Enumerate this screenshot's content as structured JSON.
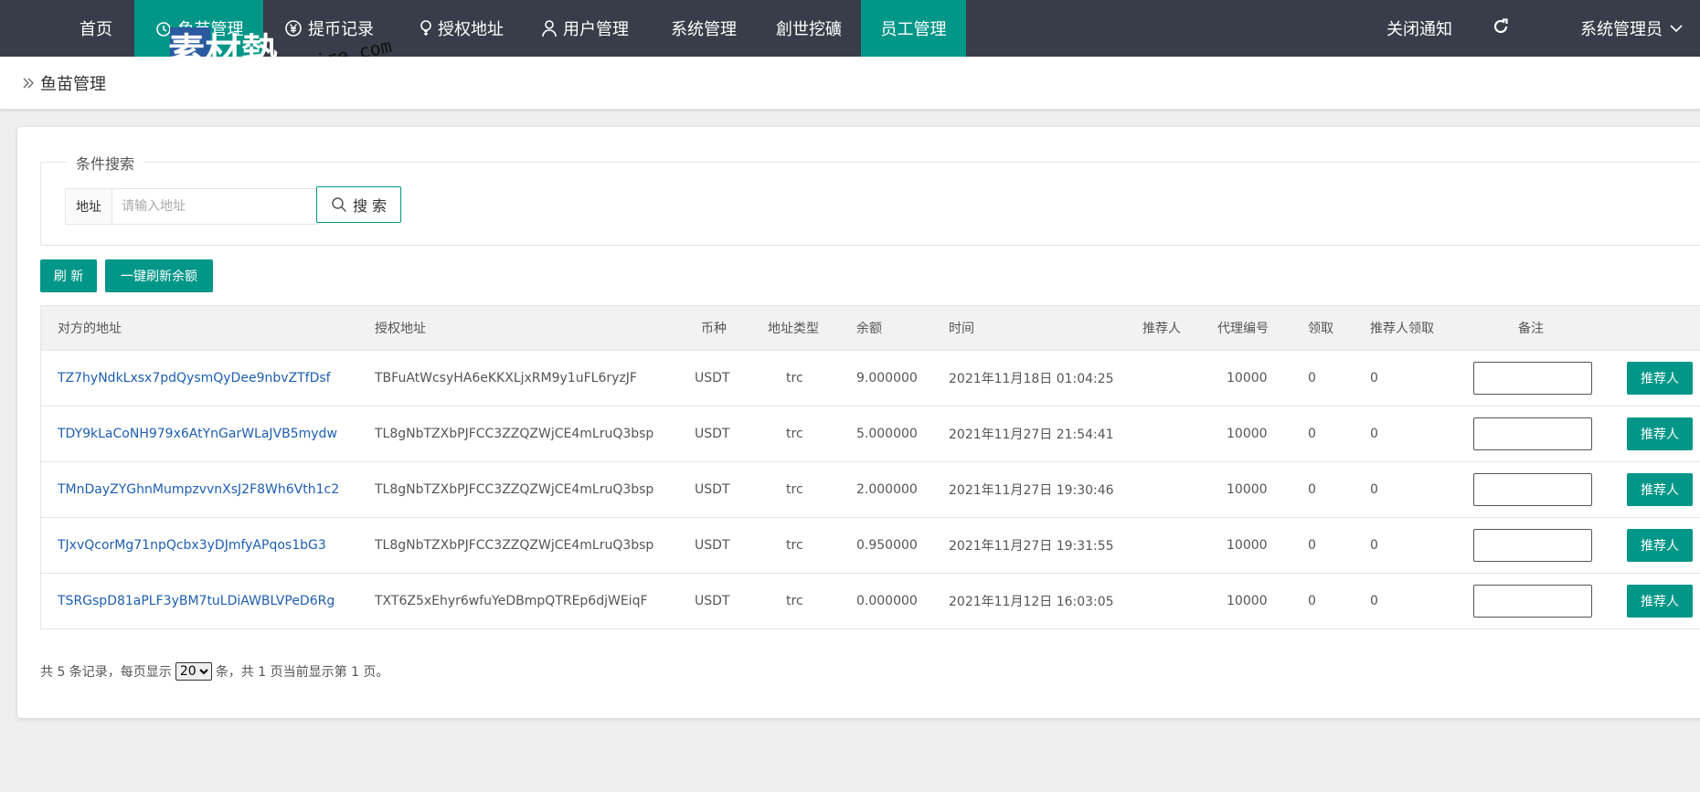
{
  "nav": {
    "items": [
      {
        "label": "首页"
      },
      {
        "label": "鱼苗管理"
      },
      {
        "label": "提币记录"
      },
      {
        "label": "授权地址"
      },
      {
        "label": "用户管理"
      },
      {
        "label": "系统管理"
      },
      {
        "label": "創世挖礦"
      },
      {
        "label": "员工管理"
      }
    ],
    "notify_label": "关闭通知",
    "admin_label": "系统管理员",
    "active_color": "#009688",
    "bar_color": "#393d49"
  },
  "watermark": {
    "text_cn": "素材熱",
    "text_en": "sucaire.com"
  },
  "breadcrumb": {
    "title": "鱼苗管理"
  },
  "search": {
    "legend": "条件搜索",
    "field_label": "地址",
    "placeholder": "请输入地址",
    "button_label": "搜 索"
  },
  "actions": {
    "refresh_label": "刷 新",
    "refresh_balance_label": "一键刷新余额"
  },
  "table": {
    "headers": [
      "对方的地址",
      "授权地址",
      "币种",
      "地址类型",
      "余额",
      "时间",
      "推荐人",
      "代理编号",
      "领取",
      "推荐人领取",
      "备注"
    ],
    "rows": [
      {
        "counterparty": "TZ7hyNdkLxsx7pdQysmQyDee9nbvZTfDsf",
        "auth": "TBFuAtWcsyHA6eKKXLjxRM9y1uFL6ryzJF",
        "coin": "USDT",
        "type": "trc",
        "balance": "9.000000",
        "time": "2021年11月18日 01:04:25",
        "referrer": "",
        "agent": "10000",
        "claim": "0",
        "ref_claim": "0",
        "remark": "",
        "button": "推荐人"
      },
      {
        "counterparty": "TDY9kLaCoNH979x6AtYnGarWLaJVB5mydw",
        "auth": "TL8gNbTZXbPJFCC3ZZQZWjCE4mLruQ3bsp",
        "coin": "USDT",
        "type": "trc",
        "balance": "5.000000",
        "time": "2021年11月27日 21:54:41",
        "referrer": "",
        "agent": "10000",
        "claim": "0",
        "ref_claim": "0",
        "remark": "",
        "button": "推荐人"
      },
      {
        "counterparty": "TMnDayZYGhnMumpzvvnXsJ2F8Wh6Vth1c2",
        "auth": "TL8gNbTZXbPJFCC3ZZQZWjCE4mLruQ3bsp",
        "coin": "USDT",
        "type": "trc",
        "balance": "2.000000",
        "time": "2021年11月27日 19:30:46",
        "referrer": "",
        "agent": "10000",
        "claim": "0",
        "ref_claim": "0",
        "remark": "",
        "button": "推荐人"
      },
      {
        "counterparty": "TJxvQcorMg71npQcbx3yDJmfyAPqos1bG3",
        "auth": "TL8gNbTZXbPJFCC3ZZQZWjCE4mLruQ3bsp",
        "coin": "USDT",
        "type": "trc",
        "balance": "0.950000",
        "time": "2021年11月27日 19:31:55",
        "referrer": "",
        "agent": "10000",
        "claim": "0",
        "ref_claim": "0",
        "remark": "",
        "button": "推荐人"
      },
      {
        "counterparty": "TSRGspD81aPLF3yBM7tuLDiAWBLVPeD6Rg",
        "auth": "TXT6Z5xEhyr6wfuYeDBmpQTREp6djWEiqF",
        "coin": "USDT",
        "type": "trc",
        "balance": "0.000000",
        "time": "2021年11月12日 16:03:05",
        "referrer": "",
        "agent": "10000",
        "claim": "0",
        "ref_claim": "0",
        "remark": "",
        "button": "推荐人"
      }
    ]
  },
  "pager": {
    "prefix": "共 5 条记录，每页显示",
    "page_size": "20",
    "suffix": "条，共 1 页当前显示第 1 页。"
  }
}
